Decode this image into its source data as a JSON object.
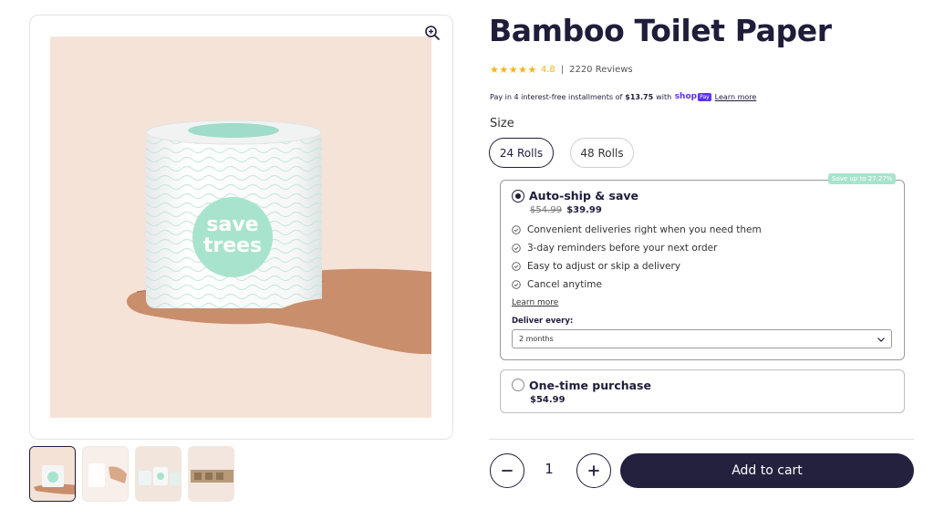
{
  "product": {
    "title": "Bamboo Toilet Paper",
    "rating": {
      "stars": "★★★★★",
      "value": "4.8",
      "separator": "|",
      "count": "2220 Reviews"
    },
    "installments": {
      "prefix": "Pay in 4 interest-free installments of",
      "amount": "$13.75",
      "with": "with",
      "shop_logo": "shop",
      "shop_badge": "Pay",
      "learn_more": "Learn more"
    },
    "logo_text_lines": [
      "save",
      "trees"
    ]
  },
  "size": {
    "label": "Size",
    "options": [
      {
        "label": "24 Rolls",
        "selected": true
      },
      {
        "label": "48 Rolls",
        "selected": false
      }
    ]
  },
  "purchase_options": {
    "autoship": {
      "badge": "Save up to 27.27%",
      "title": "Auto-ship & save",
      "old_price": "$54.99",
      "price": "$39.99",
      "checked": true,
      "benefits": [
        "Convenient deliveries right when you need them",
        "3-day reminders before your next order",
        "Easy to adjust or skip a delivery",
        "Cancel anytime"
      ],
      "learn_more": "Learn more",
      "deliver_label": "Deliver every:",
      "deliver_value": "2 months"
    },
    "onetime": {
      "title": "One-time purchase",
      "price": "$54.99",
      "checked": false
    }
  },
  "cart": {
    "quantity": "1",
    "add_label": "Add to cart"
  },
  "gallery": {
    "thumb_count": 4,
    "active_thumb": 0
  },
  "colors": {
    "brand_dark": "#24213f",
    "mint": "#a8e4cd",
    "star": "#f4b41a",
    "shop_purple": "#5a31f4",
    "hero_bg": "#f6e3d8"
  },
  "icons": {
    "zoom": "zoom-in-icon",
    "check": "check-circle-icon",
    "chevron": "chevron-down-icon",
    "minus": "minus-icon",
    "plus": "plus-icon"
  }
}
